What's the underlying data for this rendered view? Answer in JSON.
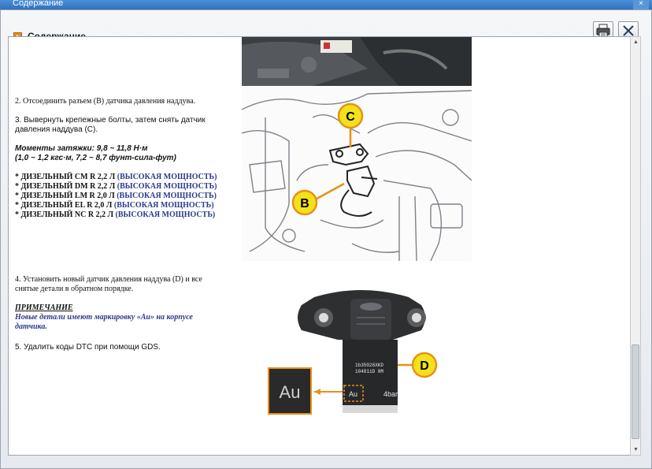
{
  "window": {
    "title": "Содержание",
    "close_glyph": "×"
  },
  "header": {
    "title": "Содержание",
    "print_icon": "printer-icon",
    "close_icon": "close-icon"
  },
  "steps": {
    "step2": "2. Отсоединить разъем (В) датчика давления наддува.",
    "step3_line1": "3. Вывернуть крепежные болты, затем снять датчик",
    "step3_line2": "давления наддува (С).",
    "torque_line1": "Моменты затяжки: 9,8 ~ 11,8 Н·м",
    "torque_line2": "(1,0 ~ 1,2 кгс·м, 7,2 ~ 8,7 фунт-сила-фут)",
    "step4_line1": "4. Установить новый датчик давления наддува (D) и все",
    "step4_line2": "снятые детали в обратном порядке.",
    "step5": "5. Удалить коды DTC при помощи GDS."
  },
  "engines": [
    {
      "name": "* ДИЗЕЛЬНЫЙ CM R 2,2 Л ",
      "power": "(ВЫСОКАЯ МОЩНОСТЬ)"
    },
    {
      "name": "* ДИЗЕЛЬНЫЙ DM R 2,2 Л ",
      "power": "(ВЫСОКАЯ МОЩНОСТЬ)"
    },
    {
      "name": "* ДИЗЕЛЬНЫЙ LM R 2,0 Л ",
      "power": "(ВЫСОКАЯ МОЩНОСТЬ)"
    },
    {
      "name": "* ДИЗЕЛЬНЫЙ EL R 2,0 Л ",
      "power": "(ВЫСОКАЯ МОЩНОСТЬ)"
    },
    {
      "name": "* ДИЗЕЛЬНЫЙ NC R 2,2 Л ",
      "power": "(ВЫСОКАЯ МОЩНОСТЬ)"
    }
  ],
  "note": {
    "title": "ПРИМЕЧАНИЕ",
    "line1": "Новые детали имеют маркировку «Au» на корпусе",
    "line2": "датчика."
  },
  "diagram": {
    "label_c": "C",
    "label_b": "B",
    "accent": "#e8901a",
    "label_fill": "#f3e21a"
  },
  "sensor": {
    "label_d": "D",
    "au_big": "Au",
    "au_small": "Au",
    "bar": "4bar",
    "code_line1": "1b35026XKD",
    "code_line2": "104811D 8M"
  },
  "colors": {
    "accent_blue": "#2c3a8c",
    "titlebar": "#3a7fcc"
  }
}
